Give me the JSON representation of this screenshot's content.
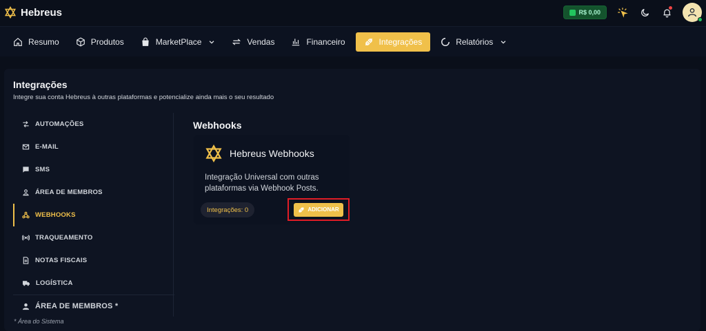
{
  "brand": {
    "name": "Hebreus"
  },
  "topbar": {
    "balance": "R$ 0,00"
  },
  "nav": {
    "items": [
      {
        "label": "Resumo"
      },
      {
        "label": "Produtos"
      },
      {
        "label": "MarketPlace"
      },
      {
        "label": "Vendas"
      },
      {
        "label": "Financeiro"
      },
      {
        "label": "Integrações"
      },
      {
        "label": "Relatórios"
      }
    ],
    "active": "Integrações"
  },
  "page": {
    "title": "Integrações",
    "subtitle": "Integre sua conta Hebreus à outras plataformas e potencialize ainda mais o seu resultado"
  },
  "sidebar": {
    "items": [
      {
        "label": "AUTOMAÇÕES",
        "icon": "automation-icon"
      },
      {
        "label": "E-MAIL",
        "icon": "email-icon"
      },
      {
        "label": "SMS",
        "icon": "sms-icon"
      },
      {
        "label": "ÁREA DE MEMBROS",
        "icon": "members-icon"
      },
      {
        "label": "WEBHOOKS",
        "icon": "webhook-icon"
      },
      {
        "label": "TRAQUEAMENTO",
        "icon": "tracking-icon"
      },
      {
        "label": "NOTAS FISCAIS",
        "icon": "invoice-icon"
      },
      {
        "label": "LOGÍSTICA",
        "icon": "truck-icon"
      },
      {
        "label": "ÁREA DE MEMBROS *",
        "icon": "user-icon"
      }
    ],
    "active": "WEBHOOKS",
    "footnote": "* Área do Sistema"
  },
  "section": {
    "title": "Webhooks",
    "card": {
      "title": "Hebreus Webhooks",
      "description": "Integração Universal com outras plataformas via Webhook Posts.",
      "count_label": "Integrações: 0",
      "add_label": "ADICIONAR"
    }
  },
  "colors": {
    "accent": "#f0c04a",
    "background": "#0a0f1a",
    "highlight": "#e11d26",
    "success": "#22c55e"
  }
}
